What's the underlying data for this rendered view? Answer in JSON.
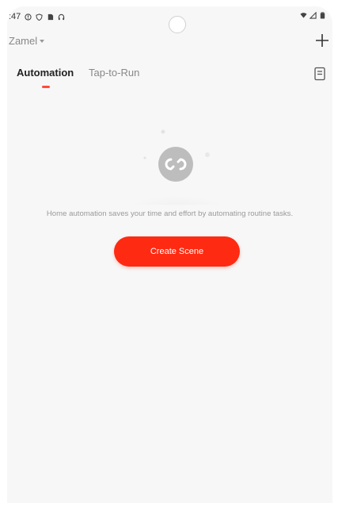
{
  "status_bar": {
    "time": ":47",
    "left_icons": [
      "alert-circle-icon",
      "shield-icon",
      "sim-icon",
      "headset-icon"
    ],
    "right_icons": [
      "wifi-icon",
      "signal-icon",
      "battery-icon"
    ]
  },
  "header": {
    "home_name": "Zamel",
    "add_icon": "plus-icon"
  },
  "tabs": [
    {
      "label": "Automation",
      "active": true
    },
    {
      "label": "Tap-to-Run",
      "active": false
    }
  ],
  "empty_state": {
    "message": "Home automation saves your time and effort by automating routine tasks.",
    "button_label": "Create Scene",
    "icon": "link-circle-icon"
  },
  "colors": {
    "accent": "#ff2a12",
    "tab_indicator": "#ff4a3d",
    "background": "#f7f7f7"
  }
}
